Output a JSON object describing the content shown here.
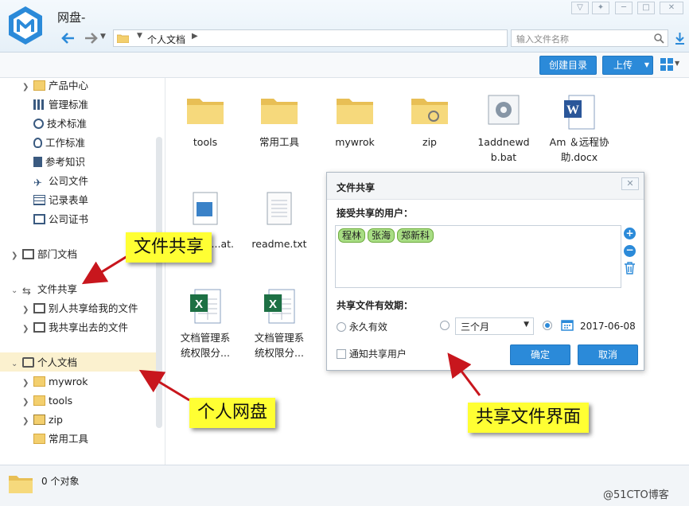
{
  "app": {
    "title": "网盘-"
  },
  "address": {
    "path": "个人文档"
  },
  "search": {
    "placeholder": "输入文件名称"
  },
  "toolbar": {
    "create_dir": "创建目录",
    "upload": "上传"
  },
  "sidebar": {
    "items": [
      {
        "label": "产品中心",
        "icon": "folder-icon"
      },
      {
        "label": "管理标准",
        "icon": "building-icon"
      },
      {
        "label": "技术标准",
        "icon": "gear-icon"
      },
      {
        "label": "工作标准",
        "icon": "pin-icon"
      },
      {
        "label": "参考知识",
        "icon": "book-icon"
      },
      {
        "label": "公司文件",
        "icon": "plane-icon"
      },
      {
        "label": "记录表单",
        "icon": "table-icon"
      },
      {
        "label": "公司证书",
        "icon": "certificate-icon"
      },
      {
        "label": "部门文档",
        "icon": "department-icon"
      },
      {
        "label": "文件共享",
        "icon": "share-icon"
      },
      {
        "label": "别人共享给我的文件",
        "icon": "share-in-icon"
      },
      {
        "label": "我共享出去的文件",
        "icon": "share-out-icon"
      },
      {
        "label": "个人文档",
        "icon": "personal-icon"
      },
      {
        "label": "mywrok",
        "icon": "folder-icon"
      },
      {
        "label": "tools",
        "icon": "folder-icon"
      },
      {
        "label": "zip",
        "icon": "zip-folder-icon"
      },
      {
        "label": "常用工具",
        "icon": "folder-icon"
      }
    ]
  },
  "files": [
    {
      "name": "tools",
      "type": "folder"
    },
    {
      "name": "常用工具",
      "type": "folder"
    },
    {
      "name": "mywrok",
      "type": "folder"
    },
    {
      "name": "zip",
      "type": "zip-folder"
    },
    {
      "name": "1addnewdb.bat",
      "type": "bat"
    },
    {
      "name": "Am ＆远程协助.docx",
      "type": "docx"
    },
    {
      "name": "...at.",
      "type": "media"
    },
    {
      "name": "readme.txt",
      "type": "txt"
    },
    {
      "name": "文档管理系统权限分...",
      "type": "xlsx"
    },
    {
      "name": "文档管理系统权限分...",
      "type": "xlsx"
    }
  ],
  "dialog": {
    "title": "文件共享",
    "users_label": "接受共享的用户：",
    "users": [
      "程林",
      "张海",
      "郑新科"
    ],
    "validity_label": "共享文件有效期：",
    "option_forever": "永久有效",
    "option_period": "三个月",
    "option_date": "2017-06-08",
    "selected_option": "date",
    "notify_label": "通知共享用户",
    "confirm": "确定",
    "cancel": "取消"
  },
  "status": {
    "count": "0 个对象"
  },
  "callouts": {
    "share": "文件共享",
    "personal": "个人网盘",
    "dialog": "共享文件界面"
  },
  "watermark": "@51CTO博客",
  "colors": {
    "accent": "#2b8ad9",
    "callout": "#ffff33",
    "arrow": "#c8161d",
    "user_tag": "#a8dd84"
  }
}
